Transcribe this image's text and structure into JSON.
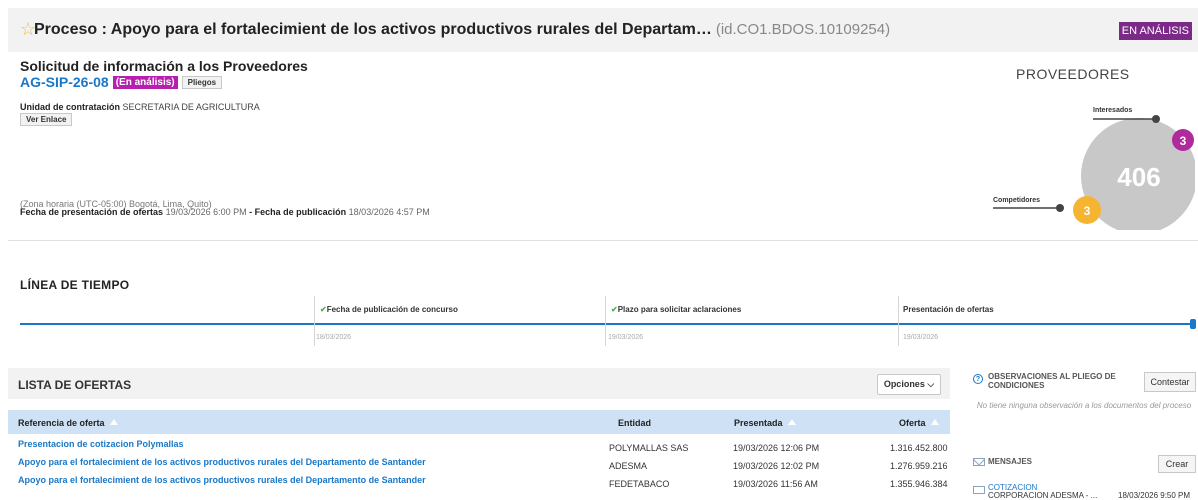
{
  "header": {
    "title": "Proceso : Apoyo para el fortalecimient de los activos productivos rurales del Departam…",
    "process_id": "(id.CO1.BDOS.10109254)",
    "status": "EN ANÁLISIS"
  },
  "summary": {
    "title": "Solicitud de información a los Proveedores",
    "reference": "AG-SIP-26-08",
    "status_badge": "(En análisis)",
    "pliegos_label": "Pliegos",
    "unit_label": "Unidad de contratación",
    "unit_value": "SECRETARIA DE AGRICULTURA",
    "ver_enlace_label": "Ver Enlace",
    "timezone": "(Zona horaria (UTC-05:00) Bogotá, Lima, Quito)",
    "offers_deadline_label": "Fecha de presentación de ofertas",
    "offers_deadline": "19/03/2026 6:00 PM",
    "dash": " - ",
    "publication_label": "Fecha de publicación",
    "publication_date": "18/03/2026 4:57 PM"
  },
  "providers": {
    "title": "PROVEEDORES",
    "total": "406",
    "interesados_label": "Interesados",
    "interesados_count": "3",
    "competidores_label": "Competidores",
    "competidores_count": "3",
    "colors": {
      "total": "#c8c8c8",
      "interesados": "#b12a9b",
      "competidores": "#f5b431"
    }
  },
  "timeline": {
    "title": "LÍNEA DE TIEMPO",
    "milestones": [
      {
        "label": "Fecha de publicación de concurso",
        "date": "18/03/2026",
        "completed": true
      },
      {
        "label": "Plazo para solicitar aclaraciones",
        "date": "19/03/2026",
        "completed": true
      },
      {
        "label": "Presentación de ofertas",
        "date": "19/03/2026",
        "completed": false
      }
    ]
  },
  "offers": {
    "title": "LISTA DE OFERTAS",
    "options_label": "Opciones",
    "columns": [
      "Referencia de oferta",
      "Entidad",
      "Presentada",
      "Oferta"
    ],
    "rows": [
      {
        "reference": "Presentacion de cotizacion Polymallas",
        "entity": "POLYMALLAS SAS",
        "submitted": "19/03/2026 12:06 PM",
        "amount": "1.316.452.800"
      },
      {
        "reference": "Apoyo para el fortalecimient de los activos productivos rurales del Departamento de Santander",
        "entity": "ADESMA",
        "submitted": "19/03/2026 12:02 PM",
        "amount": "1.276.959.216"
      },
      {
        "reference": "Apoyo para el fortalecimient de los activos productivos rurales del Departamento de Santander",
        "entity": "FEDETABACO",
        "submitted": "19/03/2026 11:56 AM",
        "amount": "1.355.946.384"
      }
    ]
  },
  "observations": {
    "title": "OBSERVACIONES AL PLIEGO DE CONDICIONES",
    "reply_label": "Contestar",
    "empty_text": "No tiene ninguna observación a los documentos del proceso"
  },
  "messages": {
    "title": "MENSAJES",
    "create_label": "Crear",
    "items": [
      {
        "subject": "COTIZACION",
        "sender": "CORPORACION ADESMA - ...",
        "date": "18/03/2026 9:50 PM"
      }
    ]
  },
  "colors": {
    "accent": "#1a78c8",
    "header_bg": "#f2f2f2",
    "table_header_bg": "#cfe2f5",
    "status_purple": "#7b2a87",
    "badge_magenta": "#b71fae"
  }
}
